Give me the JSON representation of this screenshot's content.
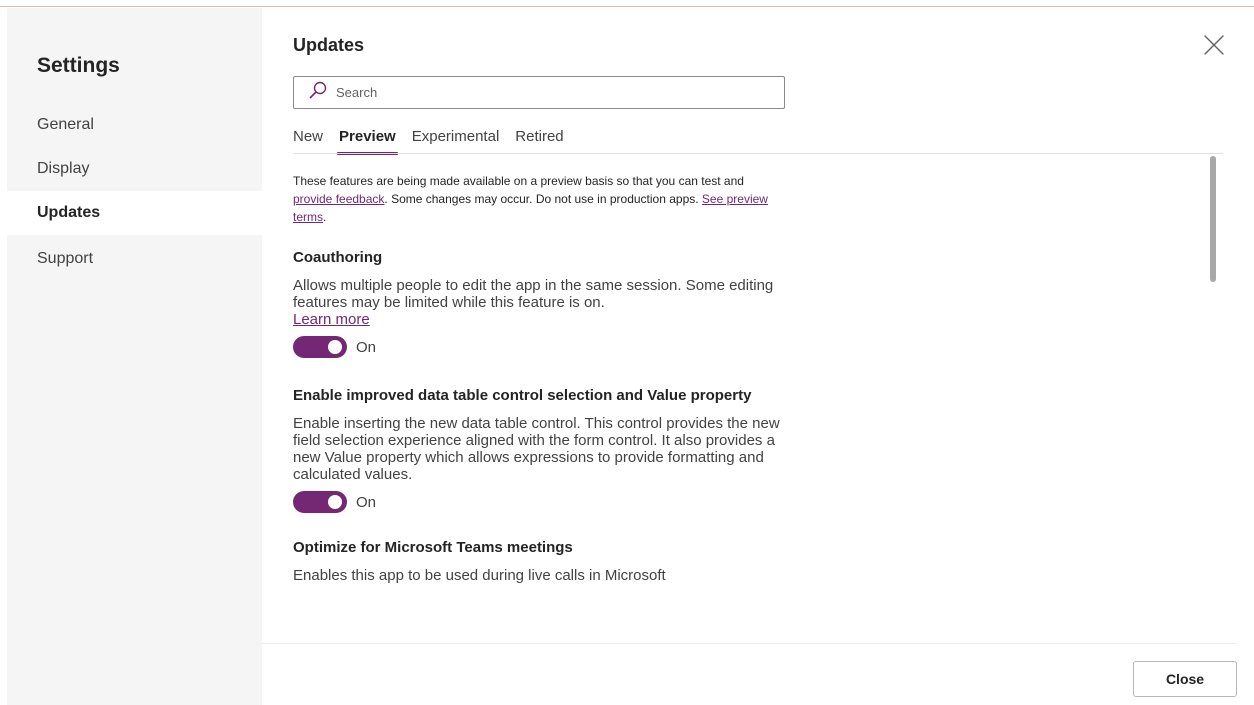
{
  "sidebar": {
    "title": "Settings",
    "items": [
      {
        "label": "General"
      },
      {
        "label": "Display"
      },
      {
        "label": "Updates"
      },
      {
        "label": "Support"
      }
    ],
    "selected": "Updates"
  },
  "main": {
    "title": "Updates",
    "search": {
      "placeholder": "Search",
      "value": ""
    },
    "tabs": [
      {
        "label": "New"
      },
      {
        "label": "Preview"
      },
      {
        "label": "Experimental"
      },
      {
        "label": "Retired"
      }
    ],
    "active_tab": "Preview",
    "intro": {
      "text1": "These features are being made available on a preview basis so that you can test and ",
      "link1": "provide feedback",
      "text2": ". Some changes may occur. Do not use in production apps. ",
      "link2": "See preview terms",
      "text3": "."
    },
    "features": [
      {
        "title": "Coauthoring",
        "description": "Allows multiple people to edit the app in the same session. Some editing features may be limited while this feature is on.",
        "link": "Learn more",
        "toggle_state": "On"
      },
      {
        "title": "Enable improved data table control selection and Value property",
        "description": "Enable inserting the new data table control. This control provides the new field selection experience aligned with the form control. It also provides a new Value property which allows expressions to provide formatting and calculated values.",
        "toggle_state": "On"
      },
      {
        "title": "Optimize for Microsoft Teams meetings",
        "description": "Enables this app to be used during live calls in Microsoft"
      }
    ]
  },
  "footer": {
    "close_label": "Close"
  },
  "colors": {
    "accent": "#742774",
    "sidebar_bg": "#f5f5f5"
  },
  "icons": {
    "search": "search-icon",
    "close": "close-icon"
  }
}
